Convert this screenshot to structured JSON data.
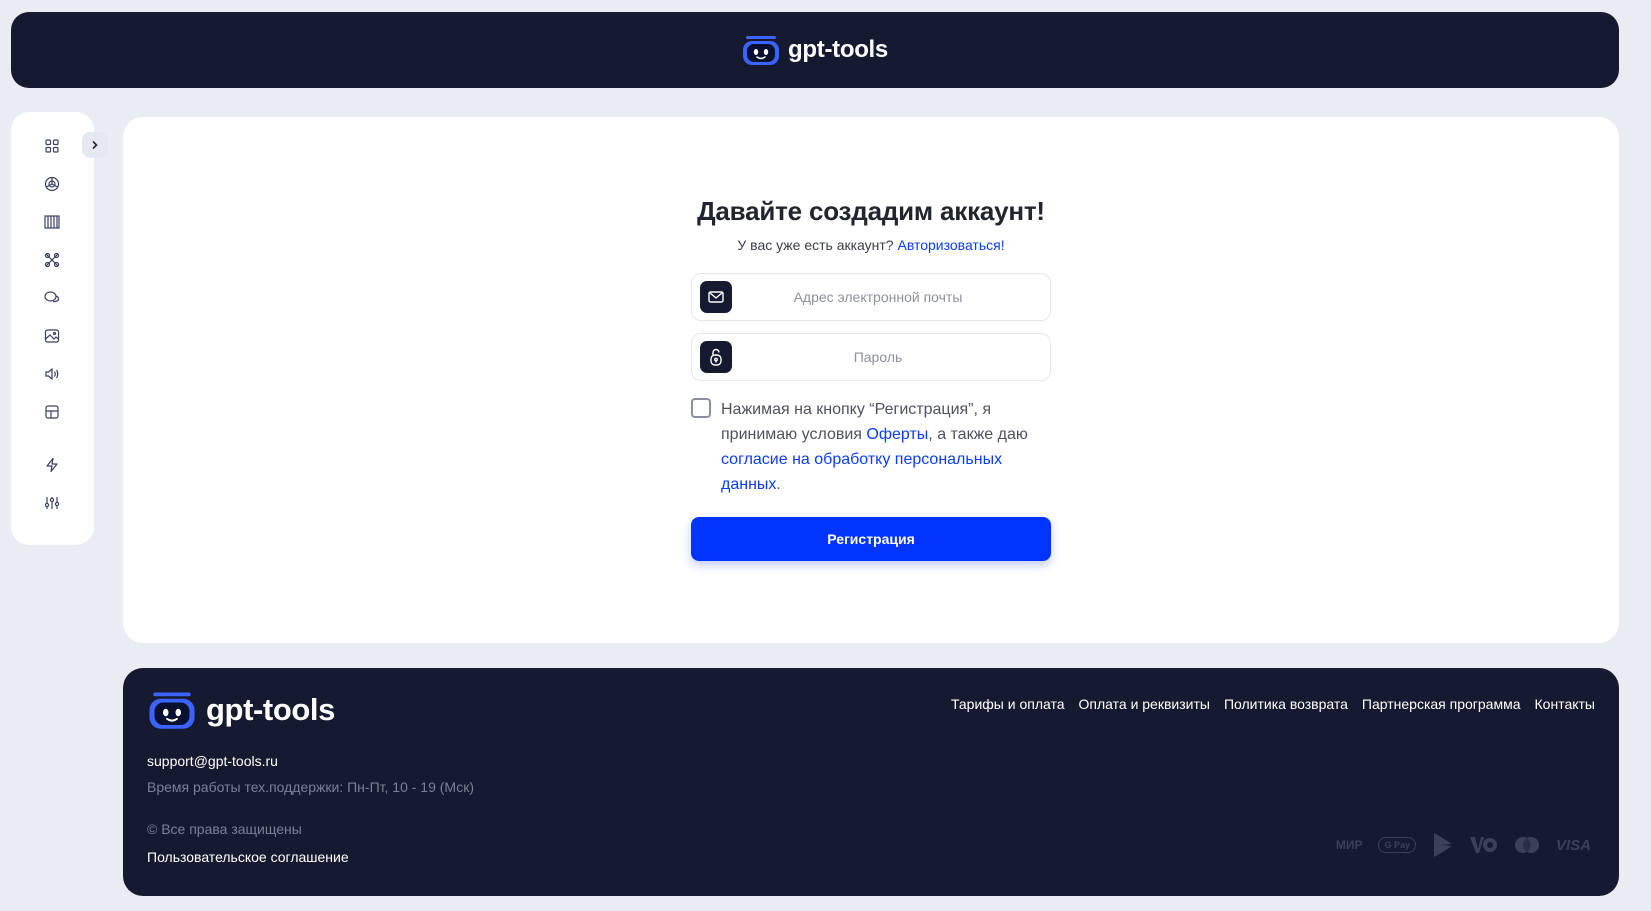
{
  "header": {
    "brand": "gpt-tools"
  },
  "sidebar": {
    "icons": [
      "grid-icon",
      "openai-icon",
      "library-icon",
      "tools-icon",
      "chat-icon",
      "image-icon",
      "audio-icon",
      "layout-icon",
      "lightning-icon",
      "sliders-icon"
    ]
  },
  "form": {
    "title": "Давайте создадим аккаунт!",
    "have_account": "У вас уже есть аккаунт?",
    "login_link": "Авторизоваться!",
    "email_placeholder": "Адрес электронной почты",
    "password_placeholder": "Пароль",
    "terms_part1": "Нажимая на кнопку “Регистрация”, я принимаю условия ",
    "terms_offer": "Оферты",
    "terms_part2": ", а также даю ",
    "terms_consent": "согласие на обработку персональных данных",
    "terms_part3": ".",
    "submit": "Регистрация"
  },
  "footer": {
    "brand": "gpt-tools",
    "links": [
      "Тарифы и оплата",
      "Оплата и реквизиты",
      "Политика возврата",
      "Партнерская программа",
      "Контакты"
    ],
    "email": "support@gpt-tools.ru",
    "hours": "Время работы тех.поддержки: Пн-Пт, 10 - 19 (Мск)",
    "rights": "© Все права защищены",
    "agreement": "Пользовательское соглашение",
    "payments": {
      "mir": "МИР",
      "gpay": "G Pay",
      "visa": "VISA"
    }
  },
  "colors": {
    "accent": "#0234ff",
    "dark": "#161a30",
    "link": "#0a3cff"
  }
}
